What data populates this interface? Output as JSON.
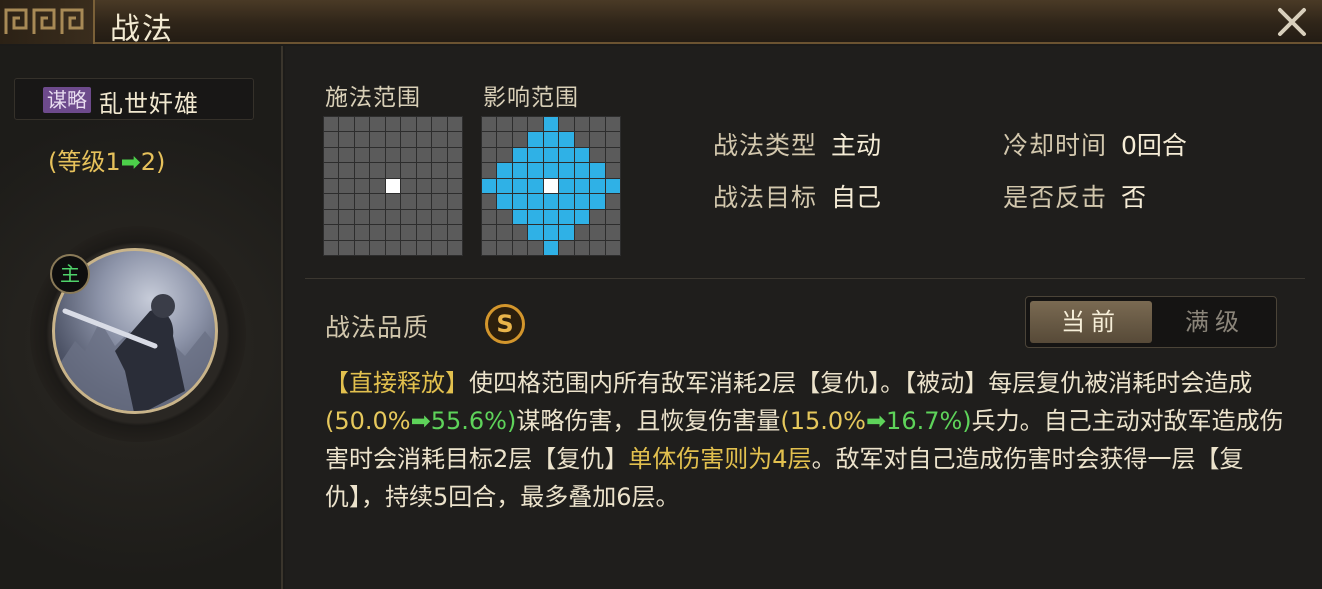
{
  "window": {
    "title": "战法"
  },
  "icons": {
    "close": "close-x-icon",
    "ornament": "meander-ornament-icon"
  },
  "skill": {
    "category_tag": "谋略",
    "name": "乱世奸雄",
    "level_prefix": "(等级",
    "level_from": "1",
    "level_arrow": "➡",
    "level_to": "2",
    "level_suffix": ")",
    "role_badge": "主"
  },
  "ranges": {
    "cast_label": "施法范围",
    "effect_label": "影响范围",
    "grid_size": 9,
    "cast_highlight": [
      [
        4,
        4
      ]
    ],
    "effect_blue": [
      [
        0,
        4
      ],
      [
        1,
        3
      ],
      [
        1,
        4
      ],
      [
        1,
        5
      ],
      [
        2,
        2
      ],
      [
        2,
        3
      ],
      [
        2,
        4
      ],
      [
        2,
        5
      ],
      [
        2,
        6
      ],
      [
        3,
        1
      ],
      [
        3,
        2
      ],
      [
        3,
        3
      ],
      [
        3,
        4
      ],
      [
        3,
        5
      ],
      [
        3,
        6
      ],
      [
        3,
        7
      ],
      [
        4,
        0
      ],
      [
        4,
        1
      ],
      [
        4,
        2
      ],
      [
        4,
        3
      ],
      [
        4,
        5
      ],
      [
        4,
        6
      ],
      [
        4,
        7
      ],
      [
        4,
        8
      ],
      [
        5,
        1
      ],
      [
        5,
        2
      ],
      [
        5,
        3
      ],
      [
        5,
        4
      ],
      [
        5,
        5
      ],
      [
        5,
        6
      ],
      [
        5,
        7
      ],
      [
        6,
        2
      ],
      [
        6,
        3
      ],
      [
        6,
        4
      ],
      [
        6,
        5
      ],
      [
        6,
        6
      ],
      [
        7,
        3
      ],
      [
        7,
        4
      ],
      [
        7,
        5
      ],
      [
        8,
        4
      ]
    ],
    "effect_center": [
      4,
      4
    ]
  },
  "info": {
    "type_key": "战法类型",
    "type_val": "主动",
    "cooldown_key": "冷却时间",
    "cooldown_val": "0回合",
    "target_key": "战法目标",
    "target_val": "自己",
    "counter_key": "是否反击",
    "counter_val": "否"
  },
  "quality": {
    "label": "战法品质",
    "grade": "S"
  },
  "toggle": {
    "current": "当前",
    "max": "满级",
    "selected": "current"
  },
  "description": {
    "p1_tag": "【直接释放】",
    "p2": "使四格范围内所有敌军消耗2层【复仇】。【被动】每层复仇被消耗时会造成",
    "p3_from": "(50.0%",
    "p3_to": "55.6%)",
    "p4": "谋略伤害，且恢复伤害量",
    "p5_from": "(15.0%",
    "p5_to": "16.7%)",
    "p6": "兵力。自己主动对敌军造成伤害时会消耗目标2层【复仇】",
    "p7": "单体伤害则为4层",
    "p8": "。敌军对自己造成伤害时会获得一层【复仇】，持续5回合，最多叠加6层。",
    "arrow": "➡"
  },
  "colors": {
    "highlight_gold": "#e2c04e",
    "upgrade_green": "#5ed35a",
    "effect_blue": "#2fb1e6",
    "tag_purple": "#6d4a8c"
  }
}
